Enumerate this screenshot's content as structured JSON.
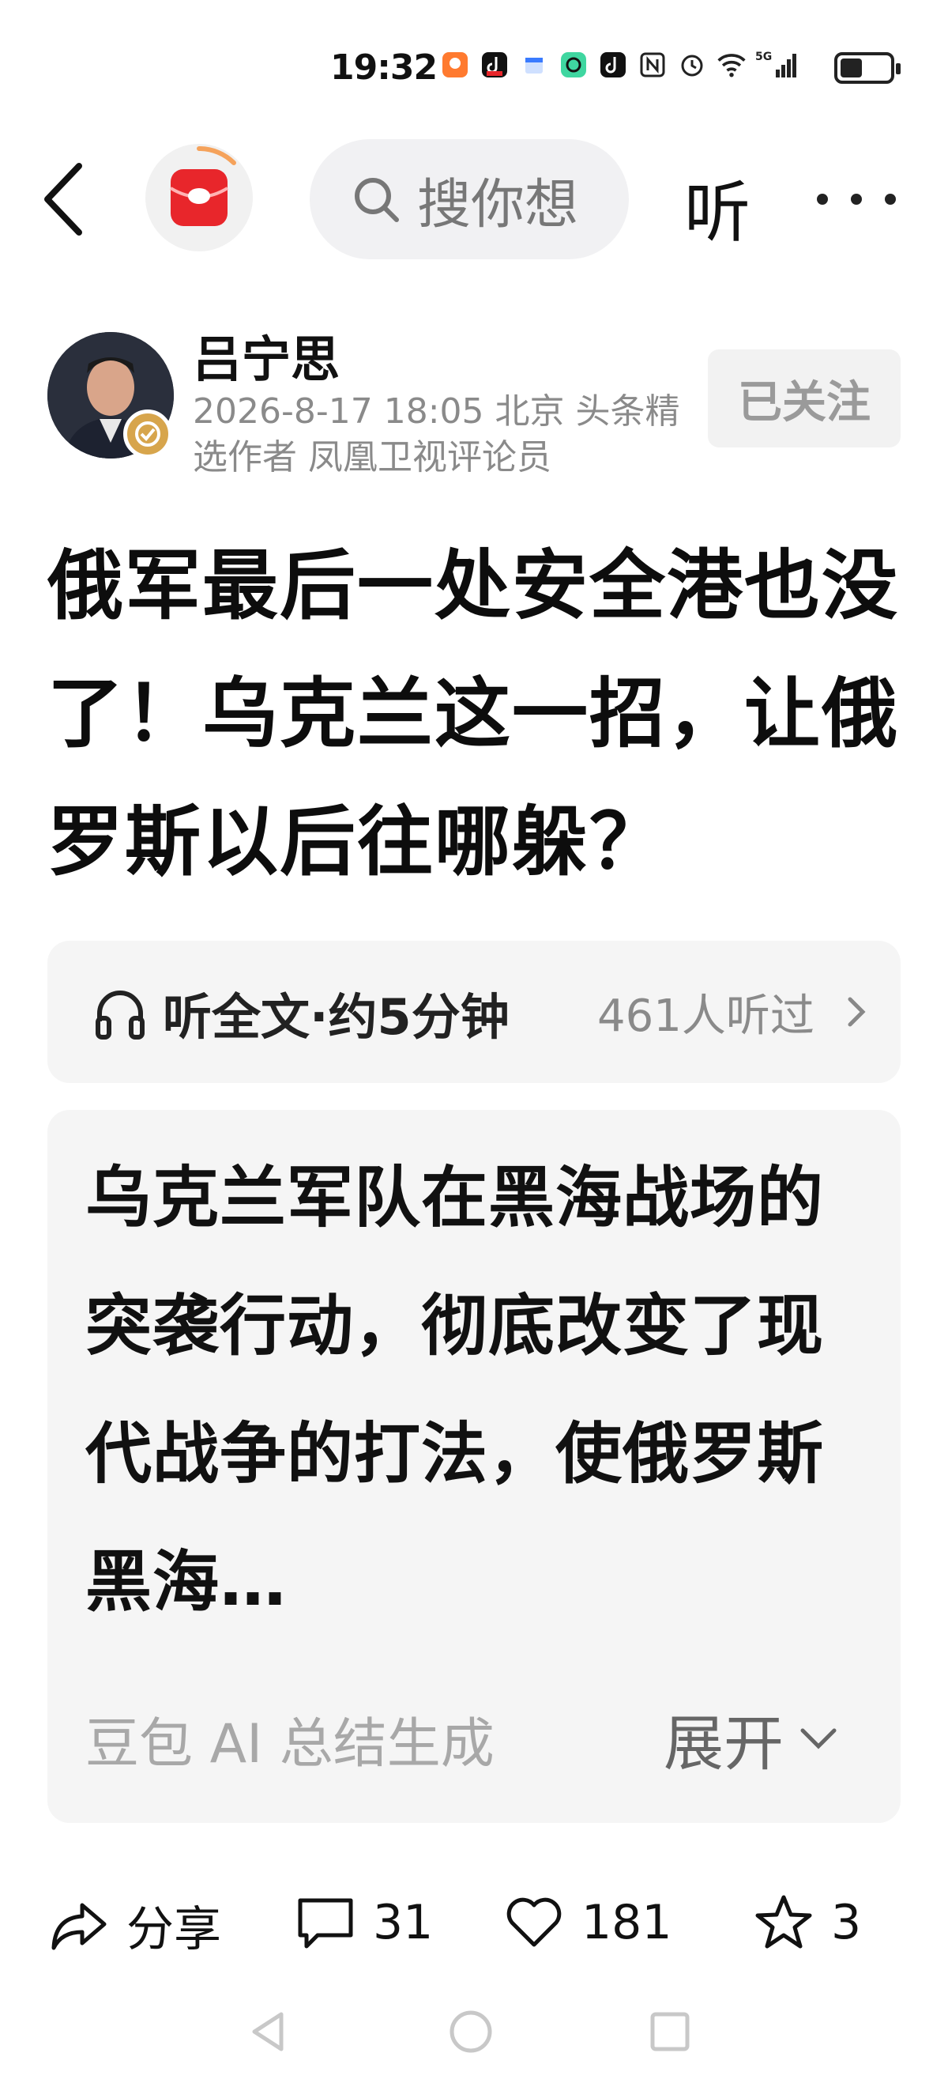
{
  "status_bar": {
    "time": "19:32",
    "icons": [
      "app-notification-icon",
      "douyin-icon",
      "calendar-icon",
      "camera-app-icon",
      "tiktok-icon",
      "nfc-icon",
      "alarm-icon",
      "wifi-icon",
      "signal-5g-icon"
    ],
    "network_label": "5G",
    "battery_level": 0.45
  },
  "nav": {
    "search_placeholder": "搜你想",
    "listen_label": "听"
  },
  "author": {
    "name": "吕宁思",
    "meta": "2026-8-17  18:05  北京  头条精选作者 凤凰卫视评论员",
    "follow_label": "已关注"
  },
  "article": {
    "title": "俄军最后一处安全港也没了！乌克兰这一招，让俄罗斯以后往哪躲？"
  },
  "listen_bar": {
    "label": "听全文·约5分钟",
    "count": "461人听过"
  },
  "ai_summary": {
    "text": "乌克兰军队在黑海战场的突袭行动，彻底改变了现代战争的打法，使俄罗斯黑海…",
    "source": "豆包 AI 总结生成",
    "expand_label": "展开"
  },
  "actions": {
    "share_label": "分享",
    "comment_count": "31",
    "like_count": "181",
    "favorite_count": "3"
  },
  "colors": {
    "brand_red": "#e8262b",
    "logo_ring": "#f5a25b",
    "verified_gold": "#d7a54c",
    "muted_text": "#8a8a8a",
    "card_bg": "#f5f5f5"
  }
}
